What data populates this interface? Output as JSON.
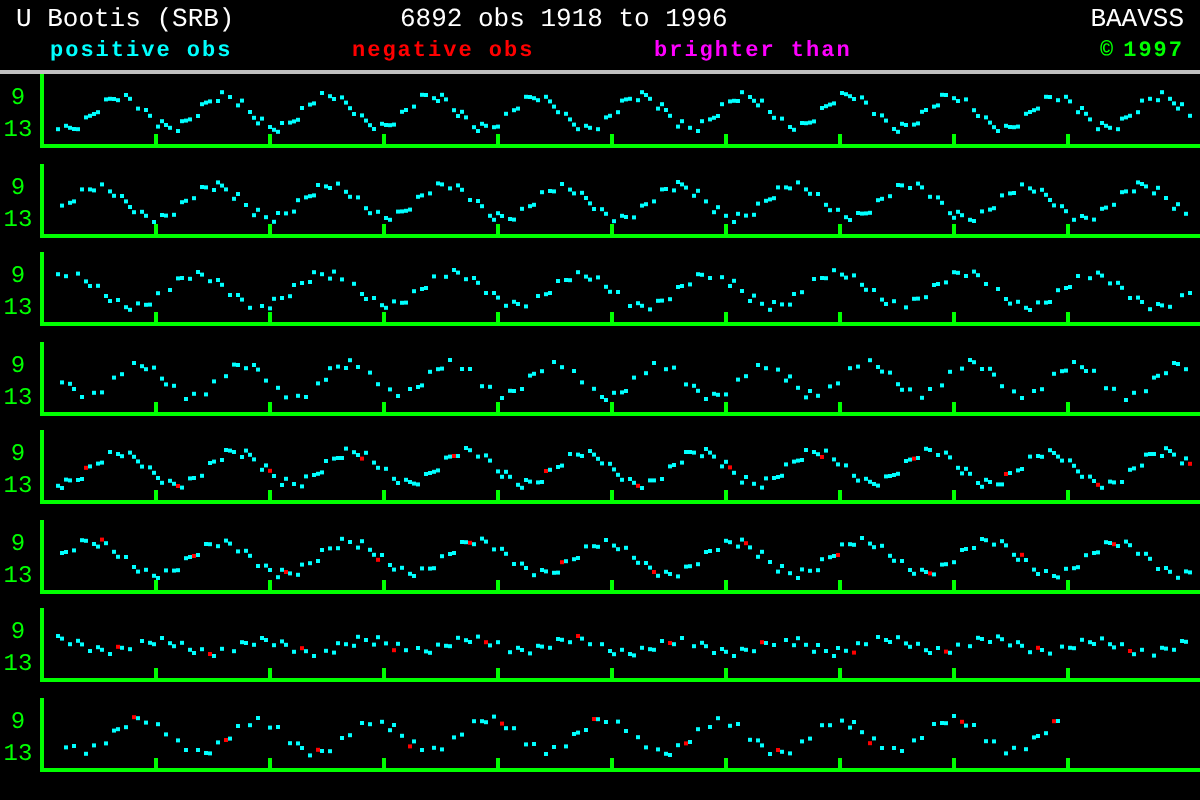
{
  "header": {
    "title": "U Bootis (SRB)",
    "summary": "6892 obs 1918 to 1996",
    "organisation": "BAAVSS"
  },
  "legend": [
    {
      "label": "positive obs",
      "color": "#00ffff"
    },
    {
      "label": "negative obs",
      "color": "#ff0000"
    },
    {
      "label": "brighter than",
      "color": "#ff00ff"
    }
  ],
  "copyright": {
    "symbol": "©",
    "year": "1997"
  },
  "panels": [
    {
      "y_labels": [
        "9",
        "13"
      ]
    },
    {
      "y_labels": [
        "9",
        "13"
      ]
    },
    {
      "y_labels": [
        "9",
        "13"
      ]
    },
    {
      "y_labels": [
        "9",
        "13"
      ]
    },
    {
      "y_labels": [
        "9",
        "13"
      ]
    },
    {
      "y_labels": [
        "9",
        "13"
      ]
    },
    {
      "y_labels": [
        "9",
        "13"
      ]
    },
    {
      "y_labels": [
        "9",
        "13"
      ]
    }
  ]
}
